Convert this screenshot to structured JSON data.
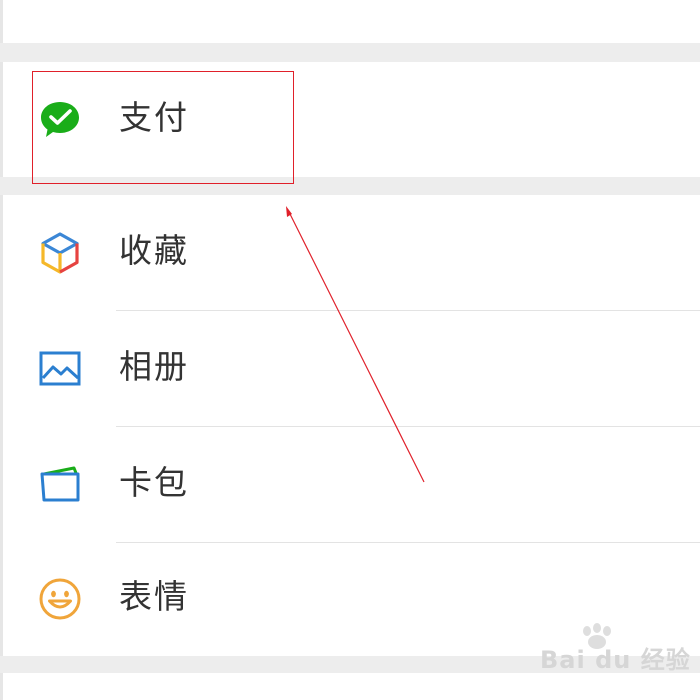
{
  "menu": {
    "pay": {
      "label": "支付",
      "icon": "wechat-pay-icon"
    },
    "items": [
      {
        "label": "收藏",
        "icon": "favorites-cube-icon"
      },
      {
        "label": "相册",
        "icon": "album-picture-icon"
      },
      {
        "label": "卡包",
        "icon": "card-wallet-icon"
      },
      {
        "label": "表情",
        "icon": "smiley-face-icon"
      }
    ]
  },
  "annotation": {
    "highlight_color": "#e0202a"
  },
  "colors": {
    "pay_green": "#1aad19",
    "favorites_blue": "#3b87d6",
    "favorites_red": "#e64340",
    "favorites_yellow": "#f5b829",
    "album_blue": "#2b7fd0",
    "card_blue": "#2b7fd0",
    "card_green": "#1aad19",
    "smiley_orange": "#f0a53a"
  },
  "watermark": {
    "text": "Bai du 经验"
  }
}
